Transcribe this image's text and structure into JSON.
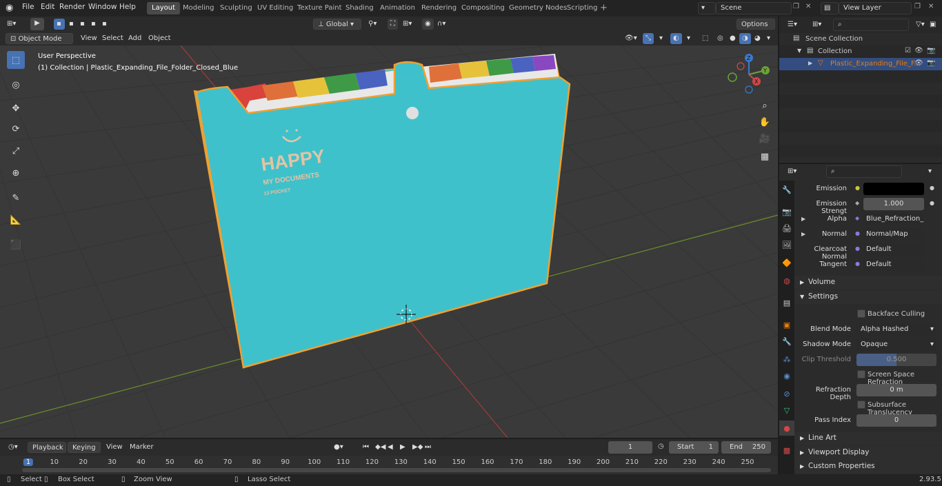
{
  "menu": {
    "file": "File",
    "edit": "Edit",
    "render": "Render",
    "window": "Window",
    "help": "Help"
  },
  "workspaces": [
    "Layout",
    "Modeling",
    "Sculpting",
    "UV Editing",
    "Texture Paint",
    "Shading",
    "Animation",
    "Rendering",
    "Compositing",
    "Geometry Nodes",
    "Scripting"
  ],
  "active_workspace": "Layout",
  "scene": "Scene",
  "view_layer": "View Layer",
  "viewport_header": {
    "transform": "Global",
    "options": "Options"
  },
  "viewport_menu": {
    "mode": "Object Mode",
    "view": "View",
    "select": "Select",
    "add": "Add",
    "object": "Object"
  },
  "overlay": {
    "perspective": "User Perspective",
    "collection": "(1) Collection | Plastic_Expanding_File_Folder_Closed_Blue"
  },
  "folder": {
    "happy": "HAPPY",
    "line2": "MY DOCUMENTS",
    "line3": "13 POCKET"
  },
  "gizmo": {
    "x": "X",
    "y": "Y",
    "z": "Z"
  },
  "outliner": {
    "scene_collection": "Scene Collection",
    "collection": "Collection",
    "object": "Plastic_Expanding_File_F..."
  },
  "properties": {
    "emission_label": "Emission",
    "emission_color": "#000000",
    "emission_strength_label": "Emission Strengt",
    "emission_strength": "1.000",
    "alpha_label": "Alpha",
    "alpha_value": "Blue_Refraction_inv...",
    "normal_label": "Normal",
    "normal_value": "Normal/Map",
    "clearcoat_label": "Clearcoat Normal",
    "clearcoat_value": "Default",
    "tangent_label": "Tangent",
    "tangent_value": "Default",
    "volume": "Volume",
    "settings": "Settings",
    "backface": "Backface Culling",
    "blend_mode_label": "Blend Mode",
    "blend_mode": "Alpha Hashed",
    "shadow_mode_label": "Shadow Mode",
    "shadow_mode": "Opaque",
    "clip_label": "Clip Threshold",
    "clip_value": "0.500",
    "ssr": "Screen Space Refraction",
    "refraction_label": "Refraction Depth",
    "refraction_value": "0 m",
    "subsurface": "Subsurface Translucency",
    "pass_label": "Pass Index",
    "pass_value": "0",
    "line_art": "Line Art",
    "viewport_display": "Viewport Display",
    "custom_props": "Custom Properties"
  },
  "timeline": {
    "playback": "Playback",
    "keying": "Keying",
    "view": "View",
    "marker": "Marker",
    "current_frame": "1",
    "start_label": "Start",
    "start": "1",
    "end_label": "End",
    "end": "250",
    "ticks": [
      "1",
      "10",
      "20",
      "30",
      "40",
      "50",
      "60",
      "70",
      "80",
      "90",
      "100",
      "110",
      "120",
      "130",
      "140",
      "150",
      "160",
      "170",
      "180",
      "190",
      "200",
      "210",
      "220",
      "230",
      "240",
      "250"
    ]
  },
  "status": {
    "select": "Select",
    "box_select": "Box Select",
    "zoom_view": "Zoom View",
    "lasso_select": "Lasso Select",
    "version": "2.93.5"
  },
  "colors": {
    "accent": "#4772b3",
    "folder": "#3fc1cb",
    "outline": "#f0a030",
    "object_orange": "#e87d0d"
  }
}
